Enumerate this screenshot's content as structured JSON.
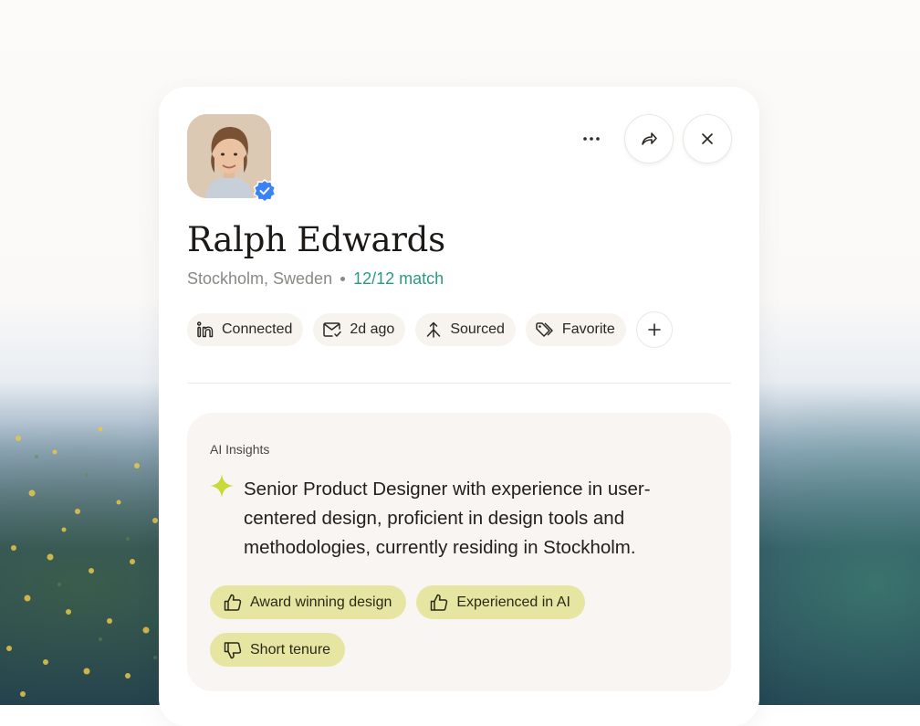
{
  "profile": {
    "name": "Ralph Edwards",
    "location": "Stockholm, Sweden",
    "match": "12/12 match"
  },
  "actions": {
    "more_icon": "more-horizontal-icon",
    "share_icon": "share-forward-icon",
    "close_icon": "close-icon"
  },
  "chips": [
    {
      "label": "Connected",
      "icon": "linkedin-icon"
    },
    {
      "label": "2d ago",
      "icon": "mail-icon"
    },
    {
      "label": "Sourced",
      "icon": "merge-arrow-icon"
    },
    {
      "label": "Favorite",
      "icon": "tag-icon"
    }
  ],
  "add_chip_icon": "plus-icon",
  "insights": {
    "label": "AI Insights",
    "summary": "Senior Product Designer with experience in user-centered design, proficient in design tools and methodologies, currently residing in Stockholm.",
    "tags": [
      {
        "label": "Award winning design",
        "sentiment": "positive",
        "icon": "thumbs-up-icon"
      },
      {
        "label": "Experienced in AI",
        "sentiment": "positive",
        "icon": "thumbs-up-icon"
      },
      {
        "label": "Short tenure",
        "sentiment": "negative",
        "icon": "thumbs-down-icon"
      }
    ]
  },
  "colors": {
    "match": "#2b9a82",
    "verified_badge": "#3b82f6",
    "tag_bg": "#e6e6a2",
    "sparkle": "#c9d93a",
    "chip_bg": "#f7f3ef"
  }
}
